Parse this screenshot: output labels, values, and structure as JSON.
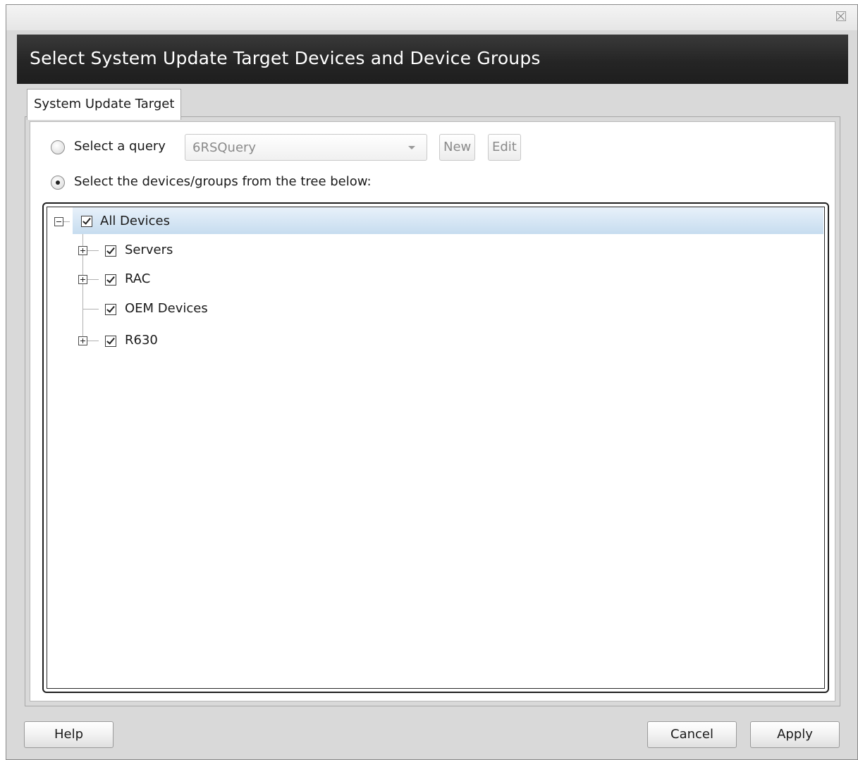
{
  "window": {
    "title": "Select System Update Target Devices and Device Groups"
  },
  "tabs": [
    {
      "label": "System Update Target",
      "active": true
    }
  ],
  "query_option": {
    "label": "Select a query",
    "selected": false,
    "combo_value": "6RSQuery",
    "new_label": "New",
    "edit_label": "Edit"
  },
  "tree_option": {
    "label": "Select the devices/groups from the tree below:",
    "selected": true
  },
  "tree": {
    "root": {
      "label": "All Devices",
      "checked": true,
      "expanded": true
    },
    "children": [
      {
        "label": "Servers",
        "checked": true,
        "expandable": true
      },
      {
        "label": "RAC",
        "checked": true,
        "expandable": true
      },
      {
        "label": "OEM Devices",
        "checked": true,
        "expandable": false
      },
      {
        "label": "R630",
        "checked": true,
        "expandable": true
      }
    ]
  },
  "footer": {
    "help_label": "Help",
    "cancel_label": "Cancel",
    "apply_label": "Apply"
  },
  "colors": {
    "header_bg": "#252525",
    "selection_bg": "#c6dcef",
    "window_bg": "#d9d9d9"
  }
}
